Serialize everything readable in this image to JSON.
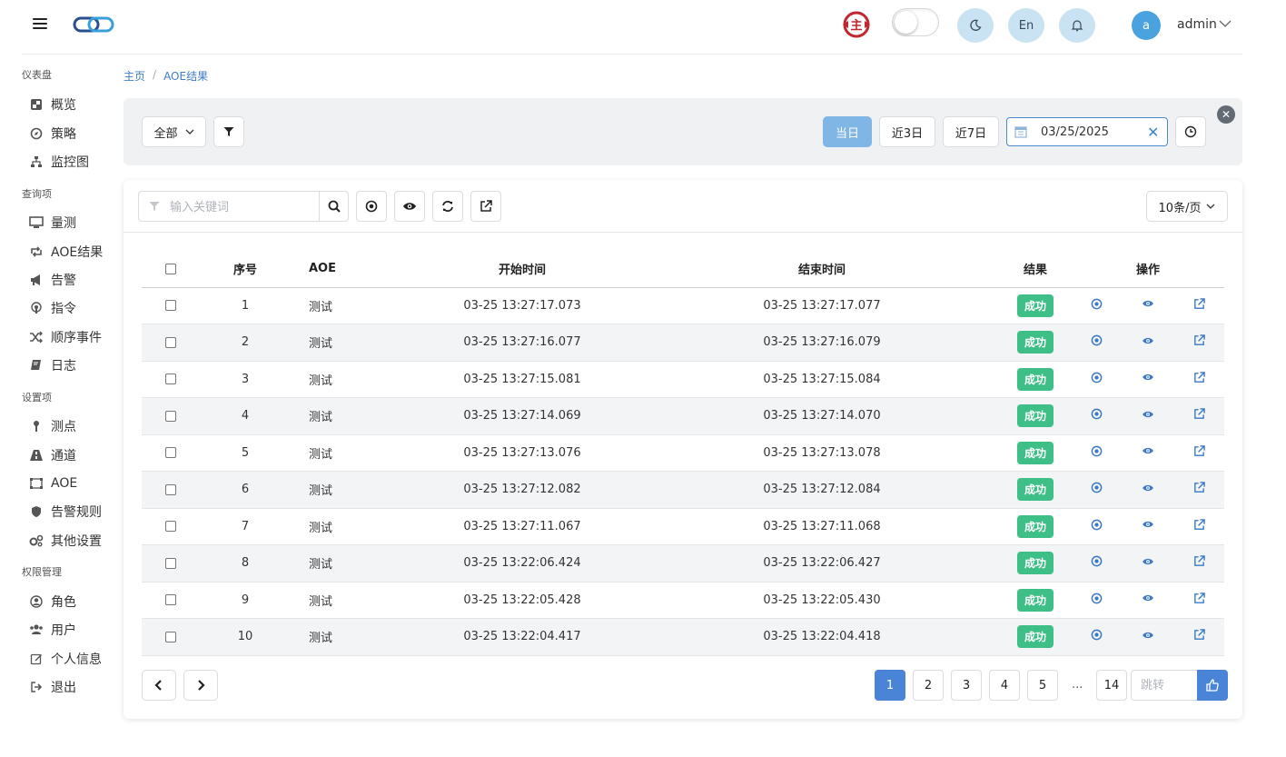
{
  "header": {
    "user_initial": "a",
    "user_name": "admin",
    "lang_label": "En",
    "brand_badge_char": "主"
  },
  "sidebar": {
    "sections": [
      {
        "title": "仪表盘",
        "items": [
          {
            "label": "概览",
            "icon": "dashboard-icon"
          },
          {
            "label": "策略",
            "icon": "compass-icon"
          },
          {
            "label": "监控图",
            "icon": "sitemap-icon"
          }
        ]
      },
      {
        "title": "查询项",
        "items": [
          {
            "label": "量测",
            "icon": "monitor-icon"
          },
          {
            "label": "AOE结果",
            "icon": "retweet-icon"
          },
          {
            "label": "告警",
            "icon": "bullhorn-icon"
          },
          {
            "label": "指令",
            "icon": "podcast-icon"
          },
          {
            "label": "顺序事件",
            "icon": "random-icon"
          },
          {
            "label": "日志",
            "icon": "book-icon"
          }
        ]
      },
      {
        "title": "设置项",
        "items": [
          {
            "label": "测点",
            "icon": "map-pin-icon"
          },
          {
            "label": "通道",
            "icon": "road-icon"
          },
          {
            "label": "AOE",
            "icon": "object-group-icon"
          },
          {
            "label": "告警规则",
            "icon": "shield-icon"
          },
          {
            "label": "其他设置",
            "icon": "cogs-icon"
          }
        ]
      },
      {
        "title": "权限管理",
        "items": [
          {
            "label": "角色",
            "icon": "user-circle-icon"
          },
          {
            "label": "用户",
            "icon": "users-icon"
          },
          {
            "label": "个人信息",
            "icon": "edit-icon"
          },
          {
            "label": "退出",
            "icon": "sign-out-icon"
          }
        ]
      }
    ]
  },
  "breadcrumb": {
    "home": "主页",
    "current": "AOE结果"
  },
  "filter": {
    "scope_select": "全部",
    "range_today": "当日",
    "range_3d": "近3日",
    "range_7d": "近7日",
    "date_value": "03/25/2025"
  },
  "toolbar": {
    "search_placeholder": "输入关键词",
    "page_size": "10条/页"
  },
  "table": {
    "columns": [
      "序号",
      "AOE",
      "开始时间",
      "结束时间",
      "结果",
      "操作"
    ],
    "rows": [
      {
        "no": "1",
        "aoe": "测试",
        "start": "03-25 13:27:17.073",
        "end": "03-25 13:27:17.077",
        "result": "成功"
      },
      {
        "no": "2",
        "aoe": "测试",
        "start": "03-25 13:27:16.077",
        "end": "03-25 13:27:16.079",
        "result": "成功"
      },
      {
        "no": "3",
        "aoe": "测试",
        "start": "03-25 13:27:15.081",
        "end": "03-25 13:27:15.084",
        "result": "成功"
      },
      {
        "no": "4",
        "aoe": "测试",
        "start": "03-25 13:27:14.069",
        "end": "03-25 13:27:14.070",
        "result": "成功"
      },
      {
        "no": "5",
        "aoe": "测试",
        "start": "03-25 13:27:13.076",
        "end": "03-25 13:27:13.078",
        "result": "成功"
      },
      {
        "no": "6",
        "aoe": "测试",
        "start": "03-25 13:27:12.082",
        "end": "03-25 13:27:12.084",
        "result": "成功"
      },
      {
        "no": "7",
        "aoe": "测试",
        "start": "03-25 13:27:11.067",
        "end": "03-25 13:27:11.068",
        "result": "成功"
      },
      {
        "no": "8",
        "aoe": "测试",
        "start": "03-25 13:22:06.424",
        "end": "03-25 13:22:06.427",
        "result": "成功"
      },
      {
        "no": "9",
        "aoe": "测试",
        "start": "03-25 13:22:05.428",
        "end": "03-25 13:22:05.430",
        "result": "成功"
      },
      {
        "no": "10",
        "aoe": "测试",
        "start": "03-25 13:22:04.417",
        "end": "03-25 13:22:04.418",
        "result": "成功"
      }
    ]
  },
  "pagination": {
    "pages": [
      "1",
      "2",
      "3",
      "4",
      "5"
    ],
    "current": "1",
    "ellipsis": "...",
    "last": "14",
    "jump_placeholder": "跳转"
  },
  "colors": {
    "accent": "#4a84d6",
    "success": "#3ebf87",
    "active_range": "#7fb6e6",
    "link": "#3f7ec6"
  }
}
